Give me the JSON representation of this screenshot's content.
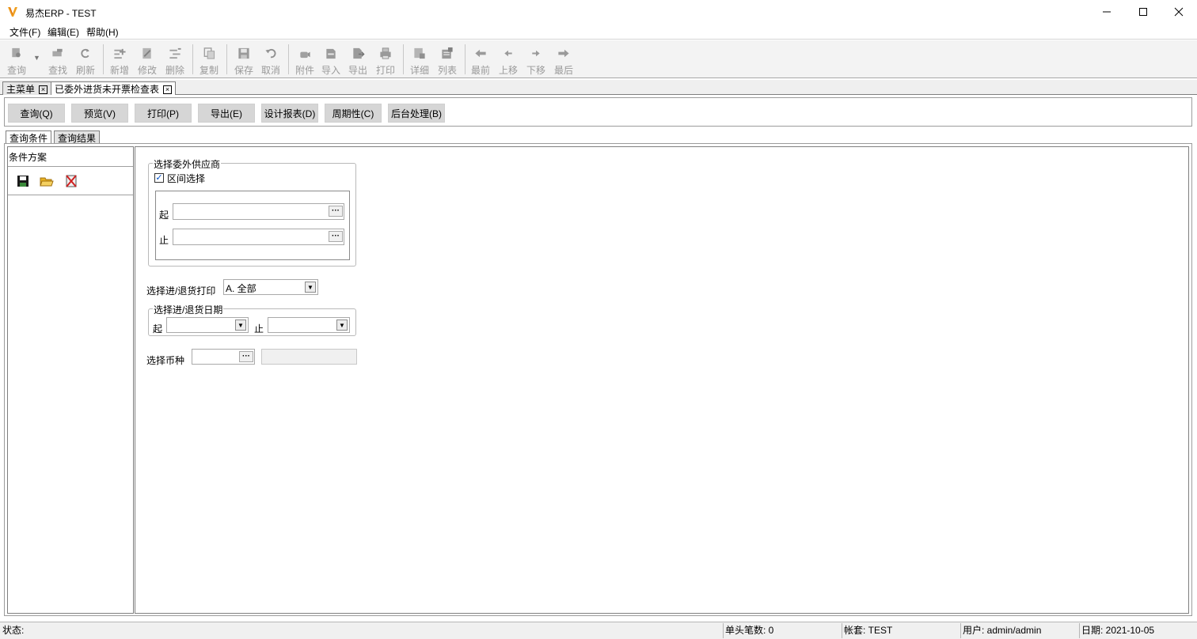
{
  "window": {
    "title": "易杰ERP - TEST",
    "logo_icon": "logo-icon",
    "controls": [
      "minimize-icon",
      "maximize-icon",
      "close-icon"
    ]
  },
  "menu": {
    "items": [
      "文件(F)",
      "编辑(E)",
      "帮助(H)"
    ]
  },
  "toolbar": {
    "buttons": [
      {
        "label": "查询",
        "icon": "query-icon"
      },
      {
        "label": "查找",
        "icon": "find-icon"
      },
      {
        "label": "刷新",
        "icon": "refresh-icon"
      },
      {
        "label": "新增",
        "icon": "add-icon"
      },
      {
        "label": "修改",
        "icon": "edit-icon"
      },
      {
        "label": "删除",
        "icon": "delete-icon"
      },
      {
        "label": "复制",
        "icon": "copy-icon"
      },
      {
        "label": "保存",
        "icon": "save-icon"
      },
      {
        "label": "取消",
        "icon": "undo-icon"
      },
      {
        "label": "附件",
        "icon": "attachment-icon"
      },
      {
        "label": "导入",
        "icon": "import-icon"
      },
      {
        "label": "导出",
        "icon": "export-icon"
      },
      {
        "label": "打印",
        "icon": "print-icon"
      },
      {
        "label": "详细",
        "icon": "detail-icon"
      },
      {
        "label": "列表",
        "icon": "list-icon"
      },
      {
        "label": "最前",
        "icon": "first-icon"
      },
      {
        "label": "上移",
        "icon": "prev-icon"
      },
      {
        "label": "下移",
        "icon": "next-icon"
      },
      {
        "label": "最后",
        "icon": "last-icon"
      }
    ]
  },
  "doc_tabs": [
    "主菜单",
    "已委外进货未开票检查表"
  ],
  "actions": [
    "查询(Q)",
    "预览(V)",
    "打印(P)",
    "导出(E)",
    "设计报表(D)",
    "周期性(C)",
    "后台处理(B)"
  ],
  "query_tabs": [
    "查询条件",
    "查询结果"
  ],
  "left_panel": {
    "title": "条件方案",
    "icons": [
      "save-scheme-icon",
      "open-folder-icon",
      "delete-scheme-icon"
    ]
  },
  "form": {
    "supplier_group_label": "选择委外供应商",
    "range_checkbox_label": "区间选择",
    "range_checked": true,
    "from_label": "起",
    "to_label": "止",
    "from_value": "",
    "to_value": "",
    "print_label": "选择进/退货打印",
    "print_value": "A. 全部",
    "date_group_label": "选择进/退货日期",
    "date_from_label": "起",
    "date_to_label": "止",
    "currency_label": "选择币种"
  },
  "statusbar": {
    "status": "状态:",
    "records": "单头笔数: 0",
    "account": "帐套: TEST",
    "user": "用户: admin/admin",
    "date": "日期: 2021-10-05"
  },
  "colors": {
    "toolbar_disabled": "#9a9a9a",
    "button_bg": "#d6d6d6",
    "logo_orange": "#f0a020",
    "save_icon": "#1a1a1a",
    "folder_icon": "#e8b020",
    "delete_icon": "#d02020"
  }
}
